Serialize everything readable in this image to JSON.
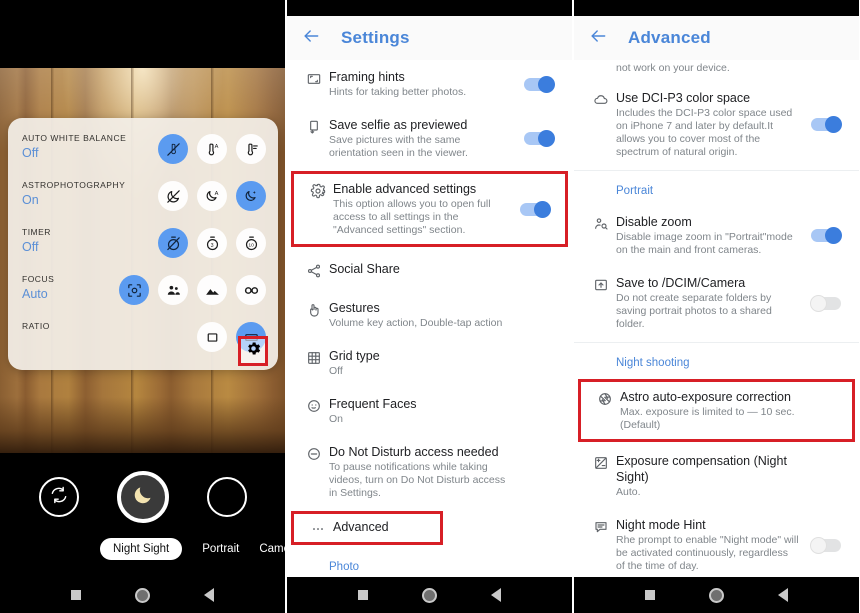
{
  "left_panel": {
    "name": "camera-viewfinder",
    "quick_settings": [
      {
        "label": "AUTO WHITE BALANCE",
        "value": "Off",
        "options": [
          "wb-auto-off-icon",
          "wb-thermometer-auto-icon",
          "wb-thermometer-icon"
        ],
        "selected": 0
      },
      {
        "label": "ASTROPHOTOGRAPHY",
        "value": "On",
        "options": [
          "astro-off-icon",
          "astro-auto-icon",
          "astro-on-icon"
        ],
        "selected": 2
      },
      {
        "label": "TIMER",
        "value": "Off",
        "options": [
          "timer-off-icon",
          "timer-3s-icon",
          "timer-10s-icon"
        ],
        "selected": 0
      },
      {
        "label": "FOCUS",
        "value": "Auto",
        "options": [
          "focus-auto-icon",
          "focus-people-icon",
          "focus-landscape-icon",
          "focus-infinity-icon"
        ],
        "selected": 0
      },
      {
        "label": "RATIO",
        "value": "",
        "options": [
          "ratio-4-3-icon",
          "ratio-16-9-icon"
        ],
        "selected": 1
      }
    ],
    "gear_button": "gear-icon",
    "controls": {
      "switch_camera": "switch-camera-icon",
      "shutter": "moon-shutter-icon",
      "gallery": "gallery-circle-icon"
    },
    "modes": [
      {
        "label": "Night Sight",
        "active": true
      },
      {
        "label": "Portrait",
        "active": false
      },
      {
        "label": "Came",
        "active": false
      }
    ]
  },
  "mid_panel": {
    "name": "settings-screen",
    "title": "Settings",
    "back_icon": "back-arrow-icon",
    "items": [
      {
        "icon": "framing-hints-icon",
        "title": "Framing hints",
        "sub": "Hints for taking better photos.",
        "toggle": "on",
        "highlighted": false
      },
      {
        "icon": "save-selfie-icon",
        "title": "Save selfie as previewed",
        "sub": "Save pictures with the same orientation seen in the viewer.",
        "toggle": "on",
        "highlighted": false
      },
      {
        "icon": "gear-icon",
        "title": "Enable advanced settings",
        "sub": "This option allows you to open full access to all settings in the \"Advanced settings\" section.",
        "toggle": "on",
        "highlighted": true
      },
      {
        "icon": "share-icon",
        "title": "Social Share",
        "sub": "",
        "toggle": "none",
        "highlighted": false
      },
      {
        "icon": "gestures-icon",
        "title": "Gestures",
        "sub": "Volume key action, Double-tap action",
        "toggle": "none",
        "highlighted": false
      },
      {
        "icon": "grid-icon",
        "title": "Grid type",
        "sub": "Off",
        "toggle": "none",
        "highlighted": false
      },
      {
        "icon": "face-icon",
        "title": "Frequent Faces",
        "sub": "On",
        "toggle": "none",
        "highlighted": false
      },
      {
        "icon": "do-not-disturb-icon",
        "title": "Do Not Disturb access needed",
        "sub": "To pause notifications while taking videos, turn on Do Not Disturb access in Settings.",
        "toggle": "none",
        "highlighted": false
      },
      {
        "icon": "more-horizontal-icon",
        "title": "Advanced",
        "sub": "",
        "toggle": "none",
        "highlighted": true
      }
    ],
    "footer_section": "Photo"
  },
  "right_panel": {
    "name": "advanced-settings-screen",
    "title": "Advanced",
    "back_icon": "back-arrow-icon",
    "clipped_text": "not work on your device.",
    "items": [
      {
        "icon": "cloud-icon",
        "title": "Use DCI-P3 color space",
        "sub": "Includes the DCI-P3 color space used on iPhone 7 and later by default.It allows you to cover most of the spectrum of natural origin.",
        "toggle": "on",
        "highlighted": false
      }
    ],
    "sections": [
      {
        "heading": "Portrait",
        "items": [
          {
            "icon": "person-zoom-icon",
            "title": "Disable zoom",
            "sub": "Disable image zoom in \"Portrait\"mode on the main and front cameras.",
            "toggle": "on",
            "highlighted": false
          },
          {
            "icon": "save-folder-icon",
            "title": "Save to /DCIM/Camera",
            "sub": "Do not create separate folders by saving portrait photos to a shared folder.",
            "toggle": "off",
            "highlighted": false
          }
        ]
      },
      {
        "heading": "Night shooting",
        "items": [
          {
            "icon": "aperture-icon",
            "title": "Astro auto-exposure correction",
            "sub": "Max. exposure is limited to — 10 sec. (Default)",
            "toggle": "none",
            "highlighted": true
          },
          {
            "icon": "exposure-icon",
            "title": "Exposure compensation (Night Sight)",
            "sub": "Auto.",
            "toggle": "none",
            "highlighted": false
          },
          {
            "icon": "hint-bubble-icon",
            "title": "Night mode Hint",
            "sub": "Rhe prompt to enable \"Night mode\" will be activated continuously, regardless of the time of day.",
            "toggle": "off",
            "highlighted": false
          }
        ]
      }
    ]
  },
  "navbar": {
    "recents": "square-icon",
    "home": "home-circle-icon",
    "back": "back-triangle-icon"
  },
  "colors": {
    "accent_blue": "#4a86d8",
    "toggle_on": "#3b7ddd",
    "toggle_track_on": "#a8c7f5",
    "toggle_off": "#e2e3e4",
    "highlight_red": "#d71f26",
    "camera_selected": "#5b9bf0"
  }
}
